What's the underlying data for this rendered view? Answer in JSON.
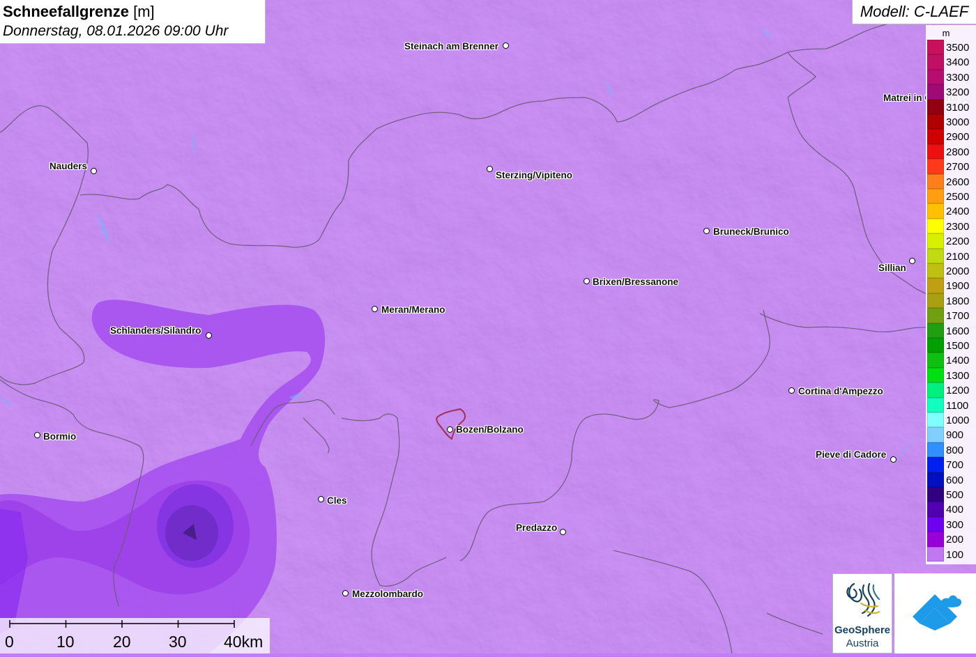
{
  "title": {
    "main": "Schneefallgrenze",
    "unit": "[m]",
    "datetime": "Donnerstag, 08.01.2026 09:00 Uhr"
  },
  "model": "Modell: C-LAEF",
  "legend": {
    "unit": "m",
    "items": [
      {
        "label": "3500",
        "color": "#c8115c"
      },
      {
        "label": "3400",
        "color": "#c20f66"
      },
      {
        "label": "3300",
        "color": "#b80d70"
      },
      {
        "label": "3200",
        "color": "#a00a74"
      },
      {
        "label": "3100",
        "color": "#900010"
      },
      {
        "label": "3000",
        "color": "#b00000"
      },
      {
        "label": "2900",
        "color": "#d00000"
      },
      {
        "label": "2800",
        "color": "#ee1010"
      },
      {
        "label": "2700",
        "color": "#ff3a1a"
      },
      {
        "label": "2600",
        "color": "#ff7f1a"
      },
      {
        "label": "2500",
        "color": "#ff9f10"
      },
      {
        "label": "2400",
        "color": "#ffc000"
      },
      {
        "label": "2300",
        "color": "#ffff00"
      },
      {
        "label": "2200",
        "color": "#d8f000"
      },
      {
        "label": "2100",
        "color": "#c0dc10"
      },
      {
        "label": "2000",
        "color": "#c0c010"
      },
      {
        "label": "1900",
        "color": "#c0a010"
      },
      {
        "label": "1800",
        "color": "#a8a010"
      },
      {
        "label": "1700",
        "color": "#70a010"
      },
      {
        "label": "1600",
        "color": "#20a010"
      },
      {
        "label": "1500",
        "color": "#00a000"
      },
      {
        "label": "1400",
        "color": "#10c010"
      },
      {
        "label": "1300",
        "color": "#00e010"
      },
      {
        "label": "1200",
        "color": "#00f080"
      },
      {
        "label": "1100",
        "color": "#10ffc0"
      },
      {
        "label": "1000",
        "color": "#80ffff"
      },
      {
        "label": "900",
        "color": "#80d0ff"
      },
      {
        "label": "800",
        "color": "#3090ff"
      },
      {
        "label": "700",
        "color": "#0020f0"
      },
      {
        "label": "600",
        "color": "#0010c0"
      },
      {
        "label": "500",
        "color": "#300080"
      },
      {
        "label": "400",
        "color": "#5000b0"
      },
      {
        "label": "300",
        "color": "#7000f0"
      },
      {
        "label": "200",
        "color": "#9800d8"
      },
      {
        "label": "100",
        "color": "#c078f0"
      }
    ]
  },
  "cities": [
    {
      "name": "Steinach am Brenner"
    },
    {
      "name": "Nauders"
    },
    {
      "name": "Sterzing/Vipiteno"
    },
    {
      "name": "Matrei in Osttirol"
    },
    {
      "name": "Bruneck/Brunico"
    },
    {
      "name": "Sillian"
    },
    {
      "name": "Brixen/Bressanone"
    },
    {
      "name": "Meran/Merano"
    },
    {
      "name": "Schlanders/Silandro"
    },
    {
      "name": "Cortina d'Ampezzo"
    },
    {
      "name": "Bormio"
    },
    {
      "name": "Bozen/Bolzano"
    },
    {
      "name": "Pieve di Cadore"
    },
    {
      "name": "Cles"
    },
    {
      "name": "Predazzo"
    },
    {
      "name": "Mezzolombardo"
    }
  ],
  "scale": {
    "labels": [
      "0",
      "10",
      "20",
      "30",
      "40km"
    ]
  },
  "logos": {
    "geosphere_line1": "GeoSphere",
    "geosphere_line2": "Austria"
  },
  "colors": {
    "map_base": "#c27cf5",
    "snowline_300": "#a44ef0",
    "snowline_200": "#9b3fe8",
    "border": "#6b5a7a"
  }
}
